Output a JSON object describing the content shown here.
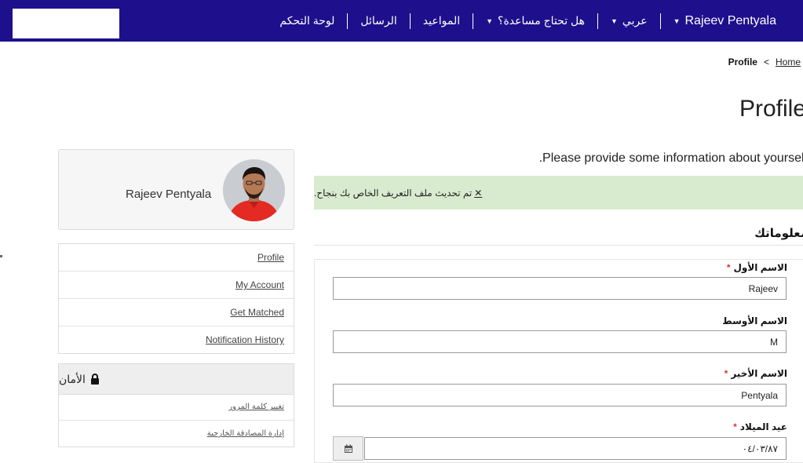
{
  "navbar": {
    "user_name": "Rajeev Pentyala",
    "language": "عربي",
    "help": "هل تحتاج مساعدة؟",
    "appointments": "المواعيد",
    "messages": "الرسائل",
    "dashboard": "لوحة التحكم"
  },
  "breadcrumb": {
    "home": "Home",
    "separator": "<",
    "current": "Profile"
  },
  "page": {
    "title": "Profile",
    "intro": ".Please provide some information about yourself",
    "alert_close": "✕",
    "alert_text": "تم تحديث ملف التعريف الخاص بك بنجاح.",
    "section_title": "معلوماتك"
  },
  "form": {
    "required_mark": "*",
    "first_name_label": "الاسم الأول",
    "first_name_value": "Rajeev",
    "middle_name_label": "الاسم الأوسط",
    "middle_name_value": "M",
    "last_name_label": "الاسم الأخير",
    "last_name_value": "Pentyala",
    "birthday_label": "عيد الميلاد",
    "birthday_value": "٠٤/٠٣/٨٧"
  },
  "sidebar": {
    "profile_name": "Rajeev Pentyala",
    "menu": {
      "profile": "Profile",
      "my_account": "My Account",
      "get_matched": "Get Matched",
      "notification_history": "Notification History"
    },
    "security": {
      "title": "الأمان",
      "change_password": "تغيير كلمة المرور",
      "external_auth": "إدارة المصادقة الخارجية"
    }
  },
  "colors": {
    "navbar_bg": "#1e0f8c",
    "alert_bg": "#d9ebcf",
    "required": "#dd3333"
  }
}
